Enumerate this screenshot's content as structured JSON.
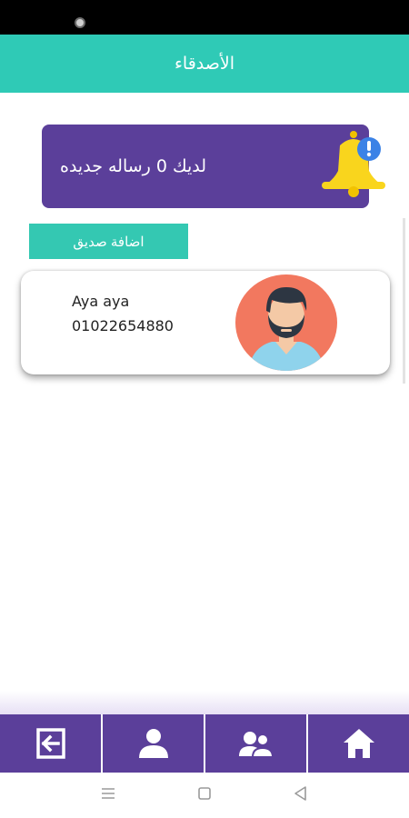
{
  "header": {
    "title": "الأصدقاء"
  },
  "banner": {
    "text": "لديك 0 رساله جديده",
    "icon": "bell-alert-icon"
  },
  "actions": {
    "add_friend_label": "اضافة صديق"
  },
  "friends": [
    {
      "name": "Aya aya",
      "phone": "01022654880",
      "avatar": "male-avatar-icon"
    }
  ],
  "bottom_nav": [
    {
      "id": "logout",
      "icon": "logout-icon"
    },
    {
      "id": "profile",
      "icon": "user-icon"
    },
    {
      "id": "friends",
      "icon": "users-icon"
    },
    {
      "id": "home",
      "icon": "home-icon"
    }
  ],
  "system_nav": [
    {
      "id": "menu",
      "icon": "menu-icon"
    },
    {
      "id": "home",
      "icon": "square-icon"
    },
    {
      "id": "back",
      "icon": "back-triangle-icon"
    }
  ],
  "colors": {
    "header": "#2fcab6",
    "purple": "#5b3f9a",
    "button": "#34c8b2",
    "bell": "#f9d51d",
    "badge": "#3b82e6"
  }
}
